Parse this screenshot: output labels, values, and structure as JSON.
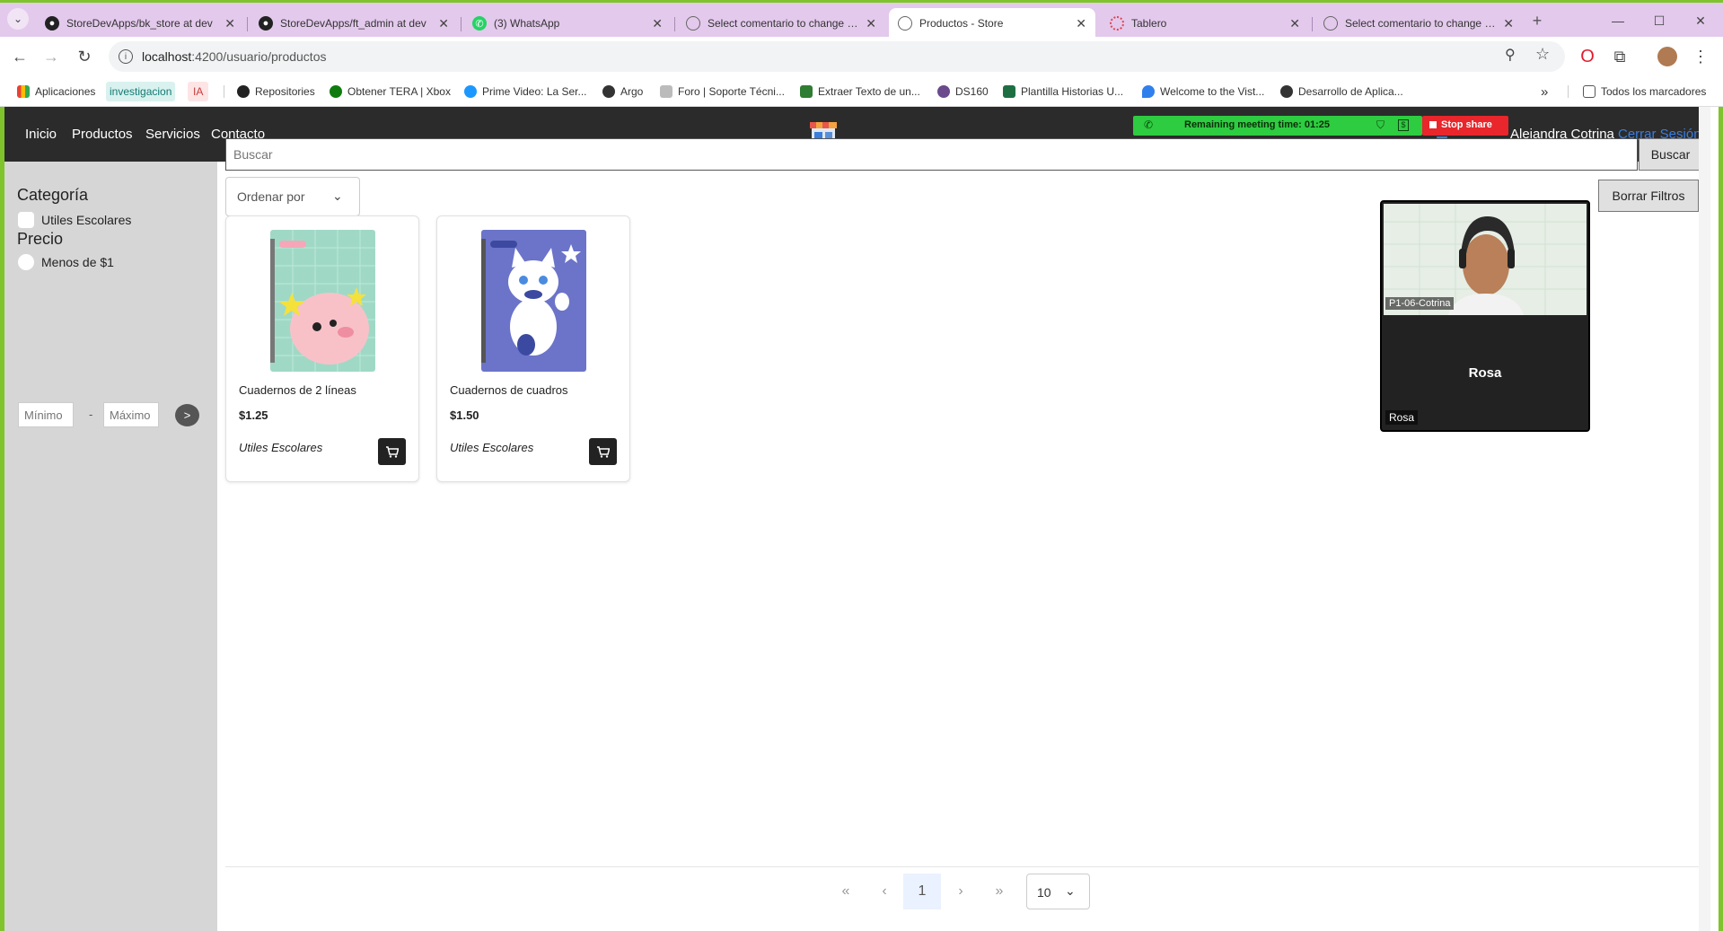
{
  "browser": {
    "tabs": [
      {
        "title": "StoreDevApps/bk_store at dev",
        "icon": "github-icon"
      },
      {
        "title": "StoreDevApps/ft_admin at dev",
        "icon": "github-icon"
      },
      {
        "title": "(3) WhatsApp",
        "icon": "whatsapp-icon"
      },
      {
        "title": "Select comentario to change | D",
        "icon": "globe-icon"
      },
      {
        "title": "Productos - Store",
        "icon": "globe-icon"
      },
      {
        "title": "Tablero",
        "icon": "loading-icon"
      },
      {
        "title": "Select comentario to change | D",
        "icon": "globe-icon"
      }
    ],
    "url_host": "localhost",
    "url_path": ":4200/usuario/productos",
    "bookmarks": [
      {
        "label": "Aplicaciones",
        "color": "#e94335"
      },
      {
        "label": "investigacion",
        "color": "#1aa39a"
      },
      {
        "label": "IA",
        "color": "#e06666"
      },
      {
        "label": "Repositories",
        "color": "#222222"
      },
      {
        "label": "Obtener TERA | Xbox",
        "color": "#107c10"
      },
      {
        "label": "Prime Video: La Ser...",
        "color": "#1a98ff"
      },
      {
        "label": "Argo",
        "color": "#333333"
      },
      {
        "label": "Foro | Soporte Técni...",
        "color": "#888888"
      },
      {
        "label": "Extraer Texto de un...",
        "color": "#2e7d32"
      },
      {
        "label": "DS160",
        "color": "#6a4a8c"
      },
      {
        "label": "Plantilla Historias U...",
        "color": "#1d6f42"
      },
      {
        "label": "Welcome to the Vist...",
        "color": "#2f80ed"
      },
      {
        "label": "Desarrollo de Aplica...",
        "color": "#333333"
      }
    ],
    "all_bookmarks": "Todos los marcadores"
  },
  "navbar": {
    "links": [
      "Inicio",
      "Productos",
      "Servicios",
      "Contacto"
    ],
    "logo": "store-logo-icon",
    "meeting_banner": "Remaining meeting time: 01:25",
    "stop_share": "Stop share",
    "user_name": "Alejandra Cotrina",
    "logout": "Cerrar Sesión"
  },
  "sidebar": {
    "category_title": "Categoría",
    "category_option": "Utiles Escolares",
    "price_title": "Precio",
    "price_option": "Menos de $1",
    "min_placeholder": "Mínimo",
    "max_placeholder": "Máximo",
    "dash": "-",
    "apply": ">"
  },
  "search": {
    "placeholder": "Buscar",
    "button": "Buscar"
  },
  "sort": {
    "label": "Ordenar por"
  },
  "clear_filters": "Borrar Filtros",
  "video": {
    "participant_1": "P1-06-Cotrina",
    "participant_2": "Rosa",
    "participant_2_tag": "Rosa"
  },
  "products": [
    {
      "name": "Cuadernos de 2 líneas",
      "price": "$1.25",
      "category": "Utiles Escolares",
      "cover_color": "#9fd9c6"
    },
    {
      "name": "Cuadernos de cuadros",
      "price": "$1.50",
      "category": "Utiles Escolares",
      "cover_color": "#6b74c8"
    }
  ],
  "pagination": {
    "first": "«",
    "prev": "‹",
    "current": "1",
    "next": "›",
    "last": "»",
    "page_size": "10"
  },
  "colors": {
    "accent": "#7fc42c",
    "navbar": "#2b2b2b",
    "sidebar": "#d6d6d6",
    "meeting_green": "#2ecc40",
    "stop_red": "#e8262b",
    "link_blue": "#3b7ddd"
  }
}
